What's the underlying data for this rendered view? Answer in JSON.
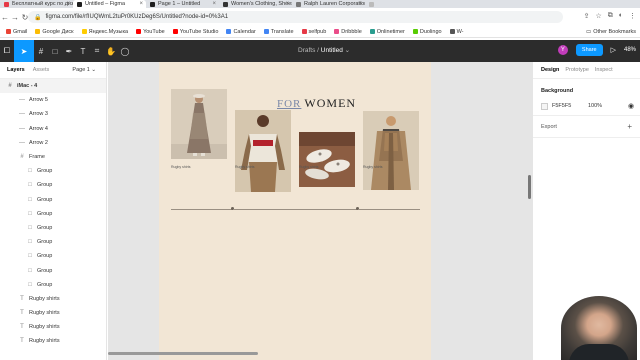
{
  "tabs": [
    {
      "label": "Бесплатный курс по дизайн",
      "color": "#e63946"
    },
    {
      "label": "Untitled – Figma",
      "color": "#1e1e1e",
      "active": true
    },
    {
      "label": "Page 1 – Untitled",
      "color": "#1e1e1e"
    },
    {
      "label": "Women's Clothing, Shoes, & A",
      "color": "#333333"
    },
    {
      "label": "Ralph Lauren Corporation",
      "color": "#777777"
    },
    {
      "label": "",
      "color": "#bbbbbb"
    }
  ],
  "url": "figma.com/file/rfIUQWmL2tuPr0KUzDeg6S/Untitled?node-id=0%3A1",
  "bookmarks": [
    {
      "label": "Gmail",
      "color": "#ea4335"
    },
    {
      "label": "Google Диск",
      "color": "#fbbc04"
    },
    {
      "label": "Яндекс.Музыка",
      "color": "#ffcc00"
    },
    {
      "label": "YouTube",
      "color": "#ff0000"
    },
    {
      "label": "YouTube Studio",
      "color": "#ff0000"
    },
    {
      "label": "Calendar",
      "color": "#4285f4"
    },
    {
      "label": "Translate",
      "color": "#4285f4"
    },
    {
      "label": "selfpub",
      "color": "#e63946"
    },
    {
      "label": "Dribbble",
      "color": "#ea4c89"
    },
    {
      "label": "Onlinetimer",
      "color": "#2a9d8f"
    },
    {
      "label": "Duolingo",
      "color": "#58cc02"
    },
    {
      "label": "W-",
      "color": "#555555"
    }
  ],
  "other_bookmarks": "Other Bookmarks",
  "file": {
    "folder": "Drafts",
    "separator": "/",
    "name": "Untitled",
    "chevron": "⌄"
  },
  "avatar_letter": "Y",
  "share_label": "Share",
  "zoom": "48%",
  "left_tabs": {
    "layers": "Layers",
    "assets": "Assets",
    "page": "Page 1"
  },
  "layers": [
    {
      "name": "iMac - 4",
      "icon": "#",
      "top": true
    },
    {
      "name": "Arrow 5",
      "icon": "—"
    },
    {
      "name": "Arrow 3",
      "icon": "—"
    },
    {
      "name": "Arrow 4",
      "icon": "—"
    },
    {
      "name": "Arrow 2",
      "icon": "—"
    },
    {
      "name": "Frame",
      "icon": "#"
    },
    {
      "name": "Group",
      "icon": "□"
    },
    {
      "name": "Group",
      "icon": "□"
    },
    {
      "name": "Group",
      "icon": "□"
    },
    {
      "name": "Group",
      "icon": "□"
    },
    {
      "name": "Group",
      "icon": "□"
    },
    {
      "name": "Group",
      "icon": "□"
    },
    {
      "name": "Group",
      "icon": "□"
    },
    {
      "name": "Group",
      "icon": "□"
    },
    {
      "name": "Group",
      "icon": "□"
    },
    {
      "name": "Rugby shirts",
      "icon": "T"
    },
    {
      "name": "Rugby shirts",
      "icon": "T"
    },
    {
      "name": "Rugby shirts",
      "icon": "T"
    },
    {
      "name": "Rugby shirts",
      "icon": "T"
    }
  ],
  "design": {
    "title_for": "FOR",
    "title_women": "WOMEN",
    "captions": [
      "Rugby shirts",
      "Rugby shirts",
      "Rugby shirts",
      "Rugby shirts"
    ]
  },
  "right_tabs": {
    "design": "Design",
    "prototype": "Prototype",
    "inspect": "Inspect"
  },
  "background": {
    "label": "Background",
    "hex": "F5F5F5",
    "opacity": "100%"
  },
  "export_label": "Export"
}
